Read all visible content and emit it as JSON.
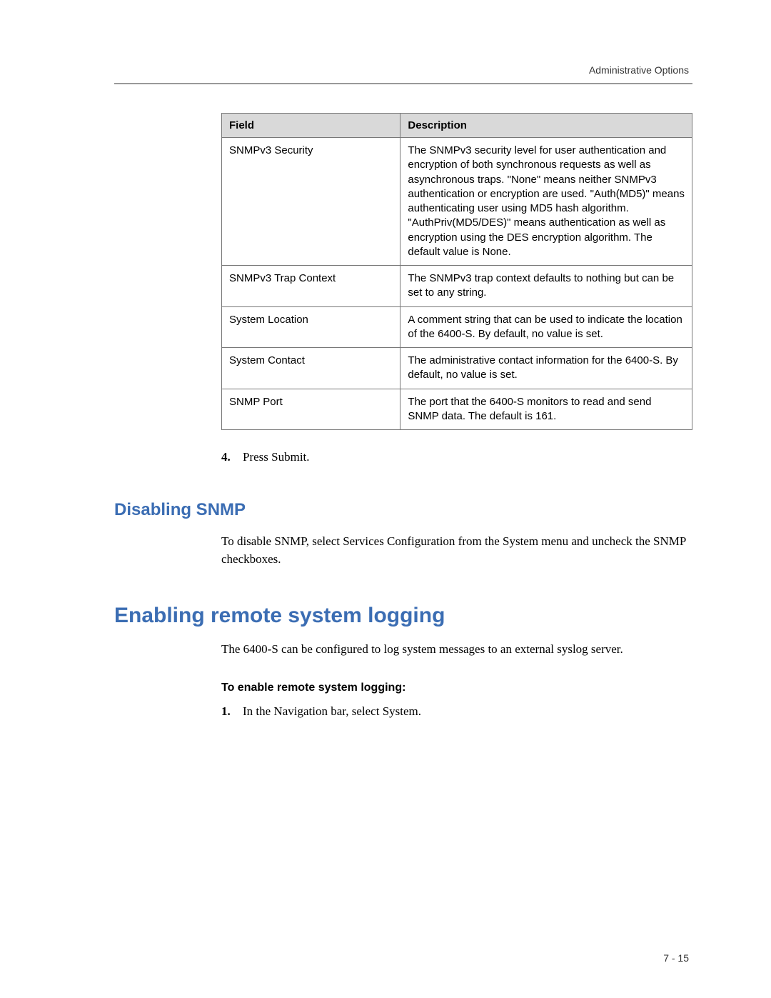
{
  "header": {
    "section": "Administrative Options"
  },
  "table": {
    "headers": {
      "field": "Field",
      "description": "Description"
    },
    "rows": [
      {
        "field": "SNMPv3 Security",
        "description": "The SNMPv3 security level for user authentication and encryption of both synchronous requests as well as asynchronous traps. \"None\" means neither SNMPv3 authentication or encryption are used. \"Auth(MD5)\" means authenticating user using MD5 hash algorithm. \"AuthPriv(MD5/DES)\" means authentication as well as encryption using the DES encryption algorithm. The default value is None."
      },
      {
        "field": "SNMPv3 Trap Context",
        "description": "The SNMPv3 trap context defaults to nothing but can be set to any string."
      },
      {
        "field": "System Location",
        "description": "A comment string that can be used to indicate the location of the 6400-S. By default, no value is set."
      },
      {
        "field": "System Contact",
        "description": "The administrative contact information for the 6400-S. By default, no value is set."
      },
      {
        "field": "SNMP Port",
        "description": "The port that the 6400-S monitors to read and send SNMP data. The default is 161."
      }
    ]
  },
  "steps_prev": {
    "num": "4.",
    "text": "Press Submit."
  },
  "section_disable": {
    "title": "Disabling SNMP",
    "body": "To disable SNMP, select Services Configuration from the System menu and uncheck the SNMP checkboxes."
  },
  "section_enable": {
    "title": "Enabling remote system logging",
    "intro": "The 6400-S can be configured to log system messages to an external syslog server.",
    "subhead": "To enable remote system logging:",
    "step1_num": "1.",
    "step1_text": "In the Navigation bar, select System."
  },
  "page_number": "7 - 15"
}
